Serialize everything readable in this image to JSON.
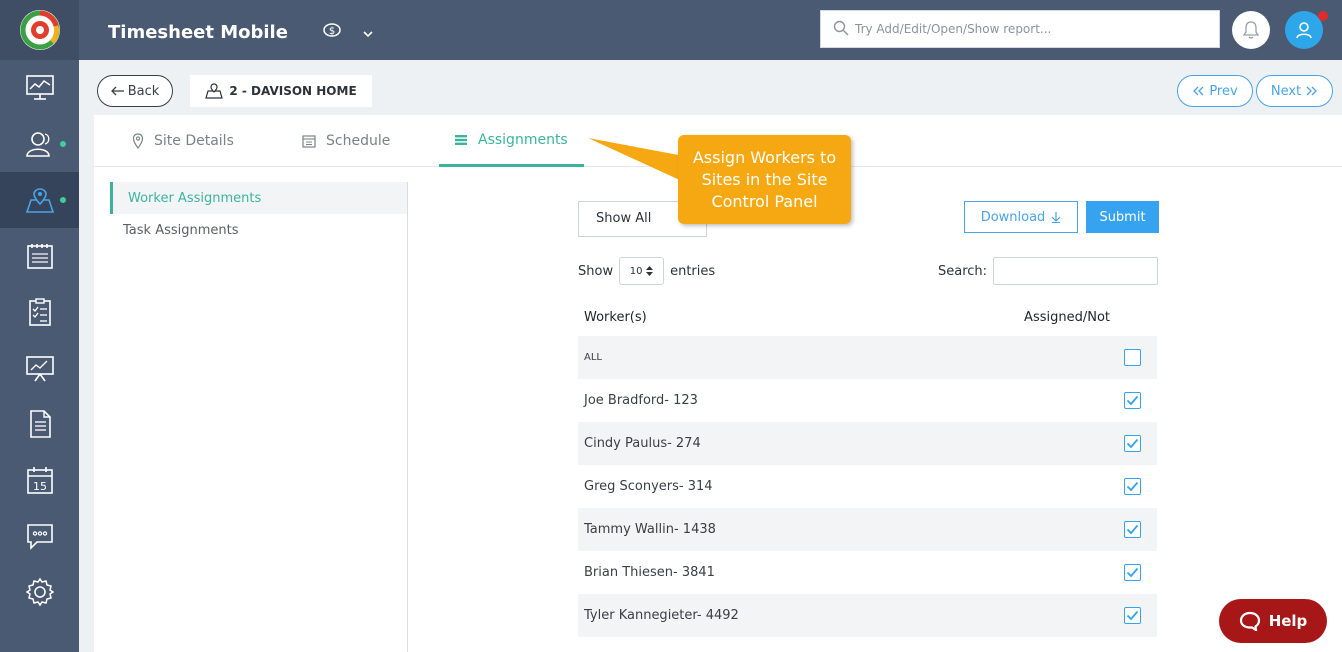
{
  "app": {
    "title": "Timesheet Mobile",
    "search_placeholder": "Try Add/Edit/Open/Show report..."
  },
  "sidebar": {
    "items": [
      {
        "icon": "dashboard-monitor-icon",
        "active": false,
        "dot": false
      },
      {
        "icon": "users-icon",
        "active": false,
        "dot": true
      },
      {
        "icon": "site-map-pin-icon",
        "active": true,
        "dot": true
      },
      {
        "icon": "timesheet-notebook-icon",
        "active": false,
        "dot": false
      },
      {
        "icon": "clipboard-checklist-icon",
        "active": false,
        "dot": false
      },
      {
        "icon": "presentation-chart-icon",
        "active": false,
        "dot": false
      },
      {
        "icon": "document-icon",
        "active": false,
        "dot": false
      },
      {
        "icon": "calendar-15-icon",
        "active": false,
        "dot": false
      },
      {
        "icon": "chat-message-icon",
        "active": false,
        "dot": false
      },
      {
        "icon": "settings-gear-icon",
        "active": false,
        "dot": false
      }
    ],
    "calendar_day": "15"
  },
  "header": {
    "back_label": "Back",
    "site_name": "2 - DAVISON HOME",
    "prev_label": "Prev",
    "next_label": "Next"
  },
  "tabs": [
    {
      "label": "Site Details",
      "active": false
    },
    {
      "label": "Schedule",
      "active": false
    },
    {
      "label": "Assignments",
      "active": true
    }
  ],
  "sub_nav": [
    {
      "label": "Worker Assignments",
      "active": true
    },
    {
      "label": "Task Assignments",
      "active": false
    }
  ],
  "controls": {
    "filter_value": "Show All",
    "download_label": "Download",
    "submit_label": "Submit",
    "show_label": "Show",
    "entries_value": "10",
    "entries_label": "entries",
    "search_label": "Search:"
  },
  "table": {
    "columns": [
      "Worker(s)",
      "Assigned/Not"
    ],
    "rows": [
      {
        "name": "ALL",
        "checked": false
      },
      {
        "name": "Joe Bradford- 123",
        "checked": true
      },
      {
        "name": "Cindy Paulus- 274",
        "checked": true
      },
      {
        "name": "Greg Sconyers- 314",
        "checked": true
      },
      {
        "name": "Tammy Wallin- 1438",
        "checked": true
      },
      {
        "name": "Brian Thiesen- 3841",
        "checked": true
      },
      {
        "name": "Tyler Kannegieter- 4492",
        "checked": true
      }
    ]
  },
  "callout": {
    "text": "Assign Workers to Sites in the Site Control Panel",
    "color": "#f6a813"
  },
  "help": {
    "label": "Help"
  },
  "colors": {
    "topbar": "#4a5a72",
    "accent_green": "#3db39e",
    "accent_blue": "#35a3ef",
    "help_red": "#a81717"
  }
}
